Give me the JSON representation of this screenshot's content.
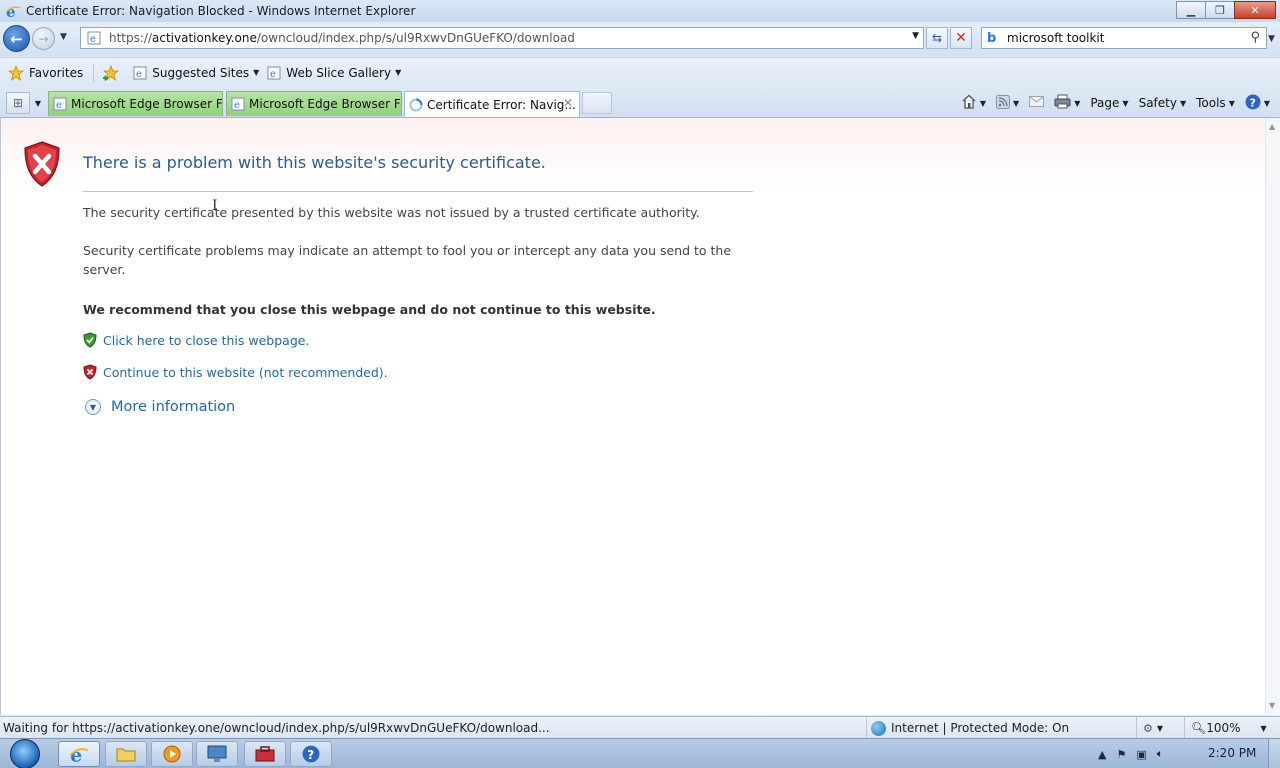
{
  "window": {
    "title": "Certificate Error: Navigation Blocked - Windows Internet Explorer"
  },
  "nav": {
    "url_prefix": "https://",
    "url_host": "activationkey.one",
    "url_path": "/owncloud/index.php/s/ul9RxwvDnGUeFKO/download",
    "search_value": "microsoft toolkit"
  },
  "favorites": {
    "favorites_label": "Favorites",
    "suggested_sites_label": "Suggested Sites",
    "web_slice_label": "Web Slice Gallery"
  },
  "tabs": [
    {
      "label": "Microsoft Edge Browser Fe..."
    },
    {
      "label": "Microsoft Edge Browser Fe..."
    },
    {
      "label": "Certificate Error: Navig..."
    }
  ],
  "command_bar": {
    "page": "Page",
    "safety": "Safety",
    "tools": "Tools"
  },
  "error_page": {
    "title": "There is a problem with this website's security certificate.",
    "para1": "The security certificate presented by this website was not issued by a trusted certificate authority.",
    "para2": "Security certificate problems may indicate an attempt to fool you or intercept any data you send to the server.",
    "recommend": "We recommend that you close this webpage and do not continue to this website.",
    "close_link": "Click here to close this webpage.",
    "continue_link": "Continue to this website (not recommended).",
    "more_info": "More information"
  },
  "status": {
    "text": "Waiting for https://activationkey.one/owncloud/index.php/s/ul9RxwvDnGUeFKO/download...",
    "zone": "Internet | Protected Mode: On",
    "zoom": "100%"
  },
  "taskbar": {
    "clock": "2:20 PM"
  },
  "colors": {
    "link": "#1e6aa3",
    "title": "#2a5d8c",
    "error_red": "#c8232b",
    "safe_green": "#3b9a34",
    "tab_green": "#9ed98a"
  }
}
